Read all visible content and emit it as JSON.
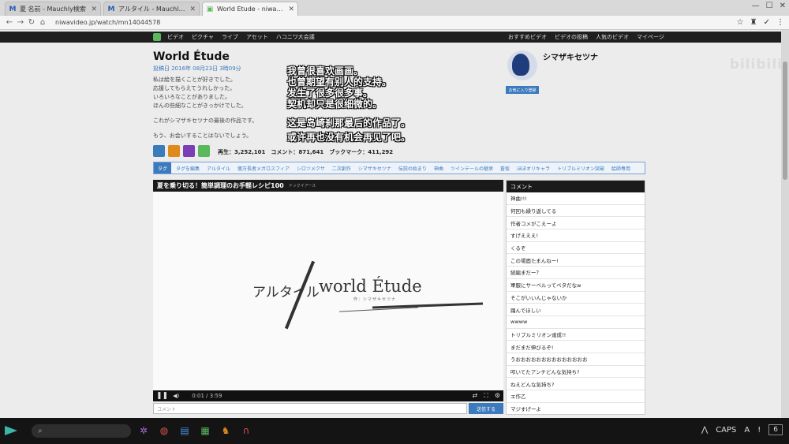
{
  "browser": {
    "tabs": [
      {
        "icon": "M",
        "title": "夏 名前 - Mauchly検索",
        "active": false
      },
      {
        "icon": "M",
        "title": "アルタイル - Mauchly検索",
        "active": false
      },
      {
        "icon": "tv",
        "title": "World Étude - niwavideo",
        "active": true
      }
    ],
    "url": "niwavideo.jp/watch/mn14044578"
  },
  "sitenav": {
    "left": [
      "ビデオ",
      "ピクチャ",
      "ライブ",
      "アセット",
      "ハコニワ大会議"
    ],
    "right": [
      "おすすめビデオ",
      "ビデオの投稿",
      "人気のビデオ",
      "マイページ"
    ]
  },
  "watermark": "bilibili",
  "video": {
    "title": "World Étude",
    "post_date": "投稿日 2016年 08月23日 3時09分",
    "description": [
      "私は絵を描くことが好きでした。",
      "応援してもらえてうれしかった。",
      "いろいろなことがありました。",
      "ほんの些細なことがきっかけでした。",
      "",
      "これがシマザキセツナの最後の作品です。",
      "",
      "もう、お会いすることはないでしょう。"
    ],
    "stats": "再生：3,252,101　コメント：871,641　ブックマーク：411,292",
    "player_title": "夏を乗り切る！簡単調理のお手軽レシピ100",
    "player_ad": "ドックイアース",
    "logo_jp": "アルタイル",
    "logo_en": "world Étude",
    "logo_sub": "作：シマザキセツナ",
    "time": "0:01 / 3:59",
    "comment_placeholder": "コメント",
    "send_label": "送信する"
  },
  "subtitles": [
    "我曾很喜欢画画。",
    "也曾期望有别人的支持。",
    "发生了很多很多事。",
    "契机却只是很细微的。",
    "这是岛崎刹那最后的作品了。",
    "或许再也没有机会再见了吧。"
  ],
  "author": {
    "name": "シマザキセツナ",
    "follow_label": "お気に入り登録"
  },
  "tags": {
    "head": "タグ",
    "items": [
      "タグを編集",
      "アルタイル",
      "億万長者メガロスフィア",
      "シロツメクサ",
      "二次創作",
      "シマザキセツナ",
      "伝説の始まり",
      "神曲",
      "ツインテールの継承",
      "蒼仮",
      "ほぼオリキャラ",
      "トリプルミリオン突破",
      "絵師専用"
    ]
  },
  "comments": {
    "head": "コメント",
    "items": [
      "神曲!!!",
      "何回も繰り返してる",
      "作者コメがこえーよ",
      "すげえええ!",
      "くるぞ",
      "この場面たまんねー!",
      "続編まだー？",
      "軍服にサーベルってベタだなw",
      "そこがいいんじゃないか",
      "踊んでほしい",
      "wwww",
      "トリプルミリオン達成!!",
      "まだまだ伸びるぞ!",
      "うおおおおおおおおおおおおおお",
      "叩いてたアンチどんな気持ち?",
      "ねえどんな気持ち?",
      "エ作乙",
      "マジすげーよ"
    ]
  },
  "taskbar": {
    "caps": "CAPS",
    "num": "6"
  },
  "colors": {
    "accent": "#3a7abd",
    "nav_bg": "#1f1f1f",
    "share": [
      "#3a7abd",
      "#e08a1e",
      "#7b3fb5",
      "#5cb85c"
    ]
  }
}
